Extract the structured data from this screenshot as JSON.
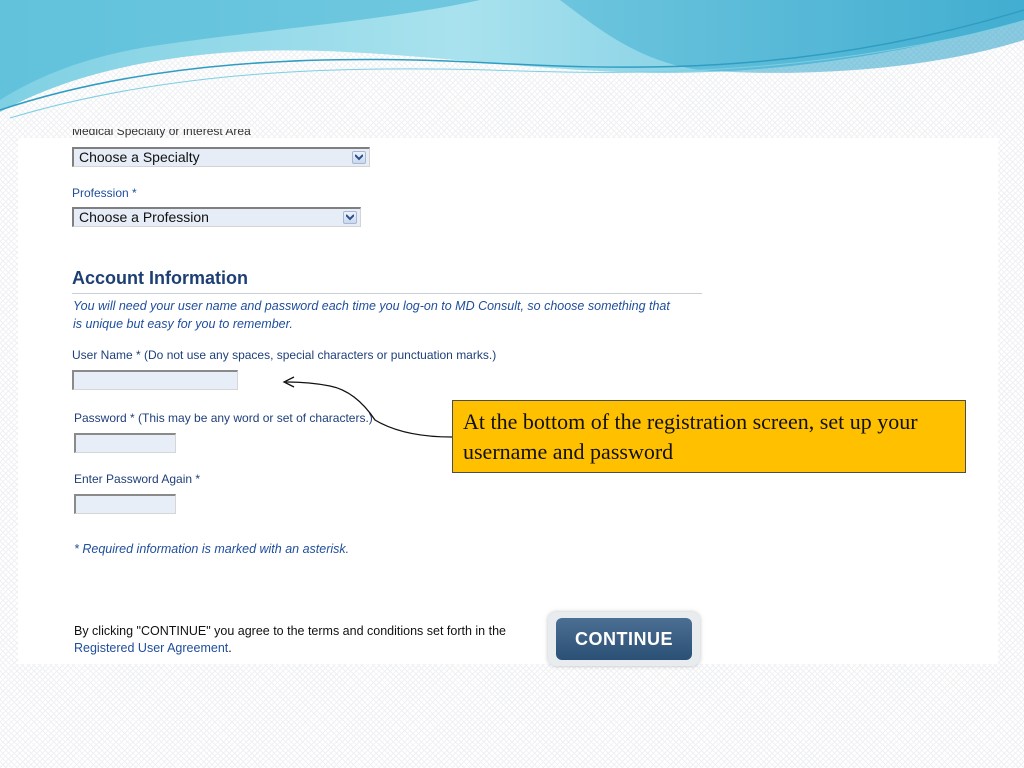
{
  "form": {
    "cut_label": "Medical Specialty or Interest Area",
    "specialty_select": "Choose a Specialty",
    "profession_label": "Profession *",
    "profession_select": "Choose a Profession"
  },
  "account": {
    "title": "Account Information",
    "intro": "You will need your user name and password each time you log-on to MD Consult, so choose something that is unique but easy for you to remember.",
    "username_label": "User Name * (Do not use any spaces, special characters or punctuation marks.)",
    "username_value": "",
    "password_label": "Password * (This may be any word or set of characters.)",
    "password_value": "",
    "password_again_label": "Enter Password Again *",
    "password_again_value": "",
    "required_note": "* Required information is marked with an asterisk."
  },
  "footer": {
    "agree_text": "By clicking \"CONTINUE\" you agree to the terms and conditions set forth in the",
    "agreement_link": "Registered User Agreement",
    "agree_end": ".",
    "continue_label": "CONTINUE"
  },
  "callout": {
    "text": "At the bottom of the registration screen, set up your username and password",
    "color": "#ffc000"
  },
  "colors": {
    "label_blue": "#1f4e9c",
    "heading_blue": "#1d3f74",
    "button_blue": "#2b5075"
  }
}
